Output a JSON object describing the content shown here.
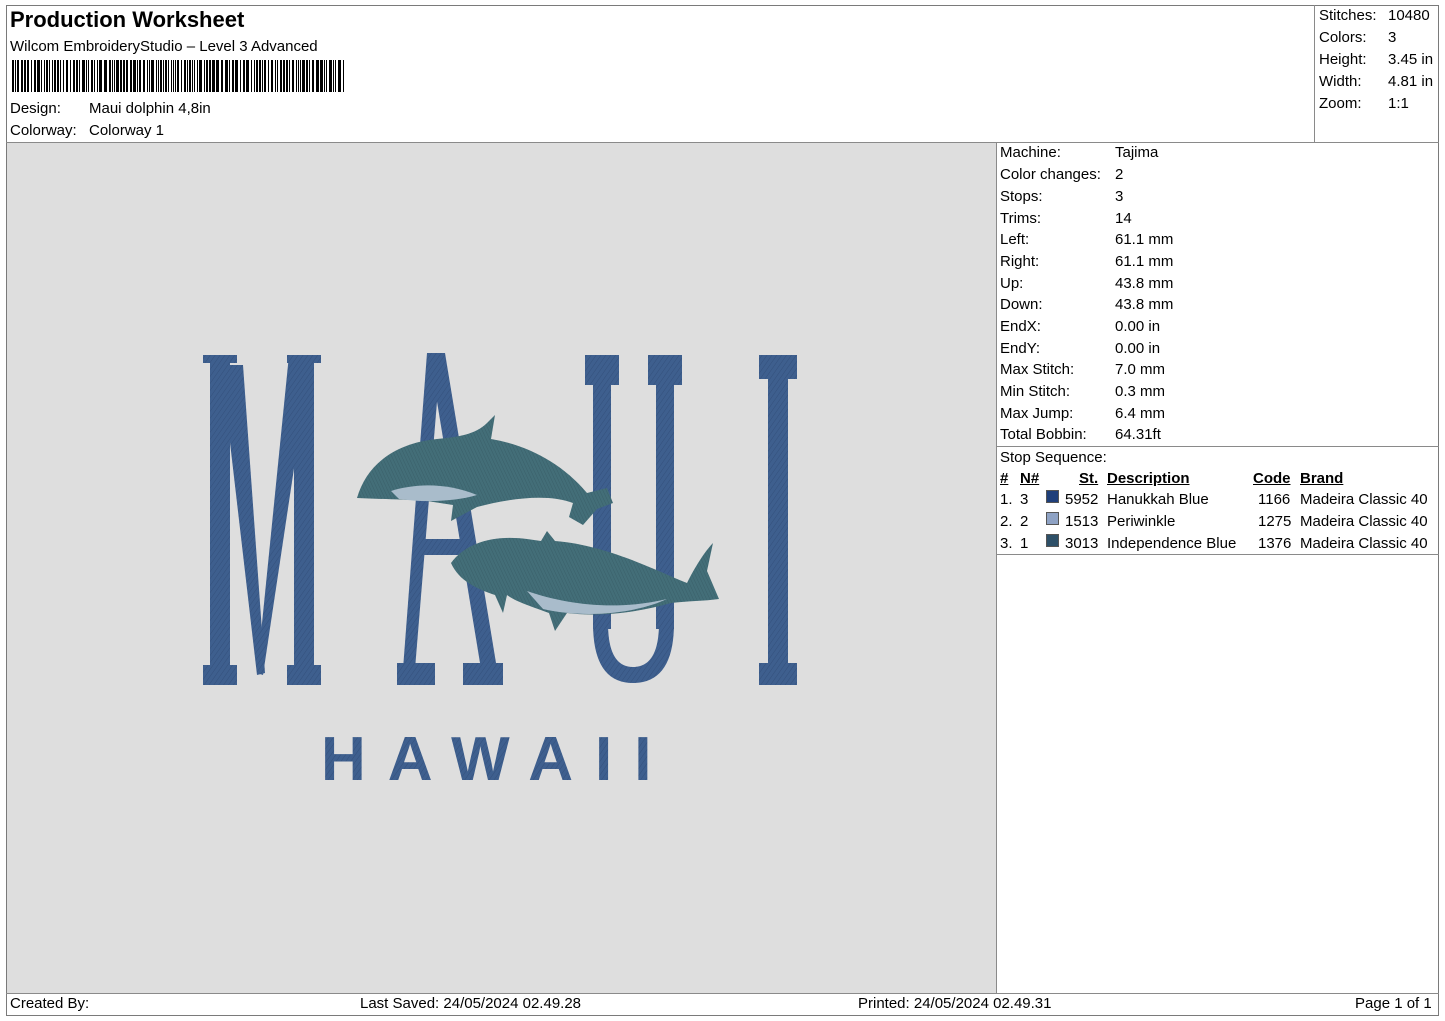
{
  "header": {
    "title": "Production Worksheet",
    "software": "Wilcom EmbroideryStudio – Level 3 Advanced",
    "barcode_label": "barcode",
    "design_label": "Design:",
    "design_value": "Maui dolphin 4,8in",
    "colorway_label": "Colorway:",
    "colorway_value": "Colorway 1"
  },
  "summary": [
    {
      "label": "Stitches:",
      "value": "10480"
    },
    {
      "label": "Colors:",
      "value": "3"
    },
    {
      "label": "Height:",
      "value": "3.45 in"
    },
    {
      "label": "Width:",
      "value": "4.81 in"
    },
    {
      "label": "Zoom:",
      "value": "1:1"
    }
  ],
  "design": {
    "main_text": "MAUI",
    "sub_text": "HAWAII",
    "colors": {
      "background": "#dedede",
      "letters": "#3e5f8e",
      "letters_dark": "#2f4d78",
      "dolphin": "#436e78",
      "dolphin_belly": "#a9bccb"
    }
  },
  "specs": [
    {
      "label": "Machine:",
      "value": "Tajima"
    },
    {
      "label": "Color changes:",
      "value": "2"
    },
    {
      "label": "Stops:",
      "value": "3"
    },
    {
      "label": "Trims:",
      "value": "14"
    },
    {
      "label": "Left:",
      "value": "61.1 mm"
    },
    {
      "label": "Right:",
      "value": "61.1 mm"
    },
    {
      "label": "Up:",
      "value": "43.8 mm"
    },
    {
      "label": "Down:",
      "value": "43.8 mm"
    },
    {
      "label": "EndX:",
      "value": "0.00 in"
    },
    {
      "label": "EndY:",
      "value": "0.00 in"
    },
    {
      "label": "Max Stitch:",
      "value": "7.0 mm"
    },
    {
      "label": "Min Stitch:",
      "value": "0.3 mm"
    },
    {
      "label": "Max Jump:",
      "value": "6.4 mm"
    },
    {
      "label": "Total Bobbin:",
      "value": "64.31ft"
    }
  ],
  "stop_sequence": {
    "title": "Stop Sequence:",
    "headers": {
      "index": "#",
      "n": "N#",
      "st": "St.",
      "description": "Description",
      "code": "Code",
      "brand": "Brand"
    },
    "rows": [
      {
        "index": "1.",
        "n": "3",
        "color": "#1f3f7a",
        "st": "5952",
        "description": "Hanukkah Blue",
        "code": "1166",
        "brand": "Madeira Classic 40"
      },
      {
        "index": "2.",
        "n": "2",
        "color": "#8ea2c4",
        "st": "1513",
        "description": "Periwinkle",
        "code": "1275",
        "brand": "Madeira Classic 40"
      },
      {
        "index": "3.",
        "n": "1",
        "color": "#2e5068",
        "st": "3013",
        "description": "Independence Blue",
        "code": "1376",
        "brand": "Madeira Classic 40"
      }
    ]
  },
  "footer": {
    "created_by": "Created By:",
    "last_saved": "Last Saved: 24/05/2024 02.49.28",
    "printed": "Printed: 24/05/2024 02.49.31",
    "page": "Page 1 of 1"
  }
}
